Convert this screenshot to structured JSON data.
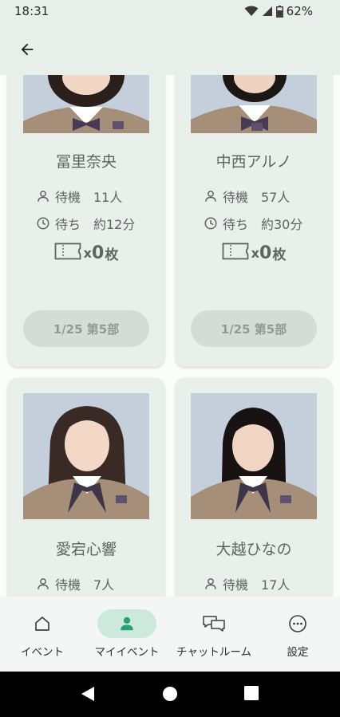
{
  "status_bar": {
    "time": "18:31",
    "battery": "62%"
  },
  "cards": [
    {
      "name": "冨里奈央",
      "waiting_label": "待機",
      "waiting_count": "11人",
      "wait_label": "待ち",
      "wait_time": "約12分",
      "ticket_x": "x",
      "ticket_count": "0",
      "ticket_unit": "枚",
      "date_label": "1/25 第5部"
    },
    {
      "name": "中西アルノ",
      "waiting_label": "待機",
      "waiting_count": "57人",
      "wait_label": "待ち",
      "wait_time": "約30分",
      "ticket_x": "x",
      "ticket_count": "0",
      "ticket_unit": "枚",
      "date_label": "1/25 第5部"
    },
    {
      "name": "愛宕心響",
      "waiting_label": "待機",
      "waiting_count": "7人"
    },
    {
      "name": "大越ひなの",
      "waiting_label": "待機",
      "waiting_count": "17人"
    }
  ],
  "bottom_nav": [
    {
      "label": "イベント",
      "icon": "home-icon",
      "active": false
    },
    {
      "label": "マイイベント",
      "icon": "person-icon",
      "active": true
    },
    {
      "label": "チャットルーム",
      "icon": "chat-icon",
      "active": false
    },
    {
      "label": "設定",
      "icon": "more-icon",
      "active": false
    }
  ],
  "colors": {
    "accent": "#3aa97c",
    "card_bg": "#e9f0eb",
    "active_pill": "#cde9dd"
  }
}
